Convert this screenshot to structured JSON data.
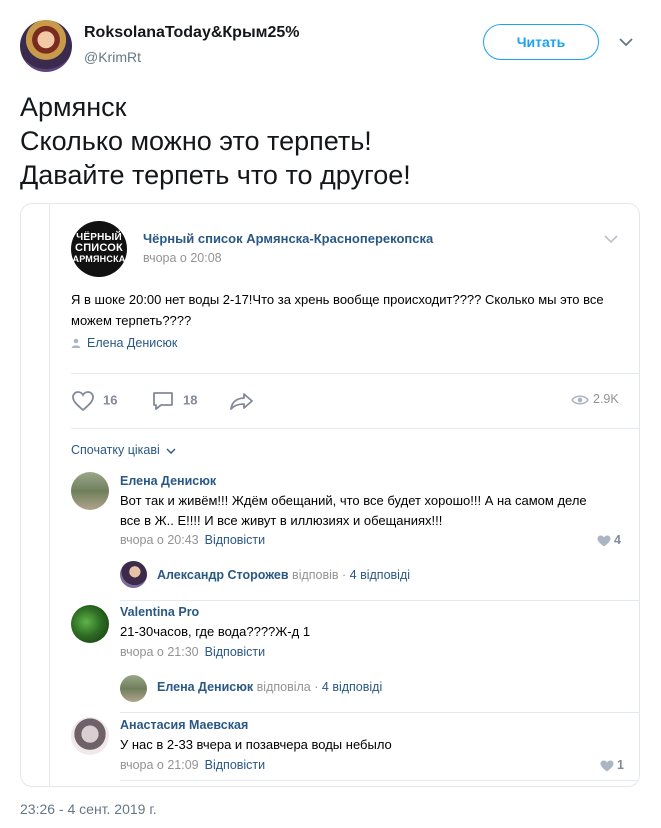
{
  "tweet": {
    "display_name": "RoksolanaToday&Крым25%",
    "handle": "@KrimRt",
    "follow_label": "Читать",
    "text_lines": [
      "Армянск",
      "Сколько можно это терпеть!",
      "Давайте терпеть что то другое!"
    ],
    "timestamp": "23:26 - 4 сент. 2019 г."
  },
  "vk": {
    "group_name": "Чёрный список Армянска-Красноперекопска",
    "group_logo_lines": [
      "ЧЁРНЫЙ",
      "СПИСОК",
      "АРМЯНСКА"
    ],
    "post_time": "вчора о 20:08",
    "post_text": "Я в шоке 20:00 нет воды 2-17!Что за хрень вообще происходит???? Сколько мы это все можем терпеть????",
    "post_author": "Елена Денисюк",
    "likes": "16",
    "comments": "18",
    "views": "2.9K",
    "sort_label": "Спочатку цікаві",
    "comments_list": [
      {
        "name": "Елена Денисюк",
        "text": "Вот так и живём!!! Ждём обещаний, что все будет хорошо!!! А на самом деле все в Ж.. Е!!!! И все живут в иллюзиях и обещаниях!!!",
        "time": "вчора о 20:43",
        "reply_label": "Відповісти",
        "likes": "4",
        "thread": {
          "name": "Александр Сторожев",
          "verb": "відповів",
          "count": "4 відповіді"
        }
      },
      {
        "name": "Valentina Pro",
        "text": "21-30часов, где вода????Ж-д 1",
        "time": "вчора о 21:30",
        "reply_label": "Відповісти",
        "likes": "",
        "thread": {
          "name": "Елена Денисюк",
          "verb": "відповіла",
          "count": "4 відповіді"
        }
      },
      {
        "name": "Анастасия Маевская",
        "text": "У нас в 2-33 вчера и позавчера воды небыло",
        "time": "вчора о 21:09",
        "reply_label": "Відповісти",
        "likes": "1"
      }
    ]
  },
  "colors": {
    "twitter_blue": "#1da1f2",
    "vk_link": "#2a5885",
    "muted": "#939393"
  },
  "icons": [
    "avatar",
    "chevron-down-icon",
    "person-icon",
    "heart-icon",
    "comment-icon",
    "share-icon",
    "eye-icon"
  ]
}
